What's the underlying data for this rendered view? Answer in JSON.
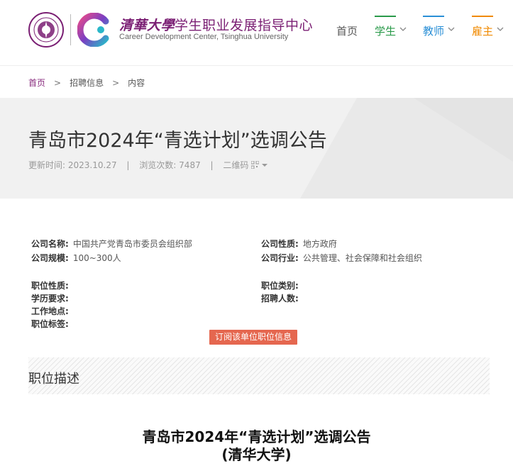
{
  "header": {
    "seal_text": "清華大學",
    "brand_cn_calli": "清華大學",
    "brand_cn_rest": "学生职业发展指导中心",
    "brand_en": "Career Development Center, Tsinghua University",
    "nav": [
      {
        "label": "首页"
      },
      {
        "label": "学生",
        "color": "#2a9a4a"
      },
      {
        "label": "教师",
        "color": "#2a8fd6"
      },
      {
        "label": "雇主",
        "color": "#f08a00"
      }
    ]
  },
  "breadcrumb": {
    "home": "首页",
    "sep": ">",
    "section": "招聘信息",
    "current": "内容"
  },
  "article": {
    "title": "青岛市2024年“青选计划”选调公告",
    "updated_label": "更新时间:",
    "updated": "2023.10.27",
    "views_label": "浏览次数:",
    "views": "7487",
    "qr_label": "二维码",
    "pipe": "|"
  },
  "company": {
    "name_label": "公司名称:",
    "name": "中国共产党青岛市委员会组织部",
    "nature_label": "公司性质:",
    "nature": "地方政府",
    "size_label": "公司规模:",
    "size": "100~300人",
    "industry_label": "公司行业:",
    "industry": "公共管理、社会保障和社会组织"
  },
  "position": {
    "nature_label": "职位性质:",
    "category_label": "职位类别:",
    "education_label": "学历要求:",
    "headcount_label": "招聘人数:",
    "location_label": "工作地点:",
    "tags_label": "职位标签:"
  },
  "actions": {
    "subscribe": "订阅该单位职位信息"
  },
  "description": {
    "heading": "职位描述",
    "body_title_line1": "青岛市2024年“青选计划”选调公告",
    "body_title_line2": "(清华大学)"
  },
  "colors": {
    "brand_purple": "#7a1e73",
    "student_green": "#2a9a4a",
    "teacher_blue": "#2a8fd6",
    "employer_orange": "#f08a00",
    "subscribe_red": "#e5674f"
  }
}
